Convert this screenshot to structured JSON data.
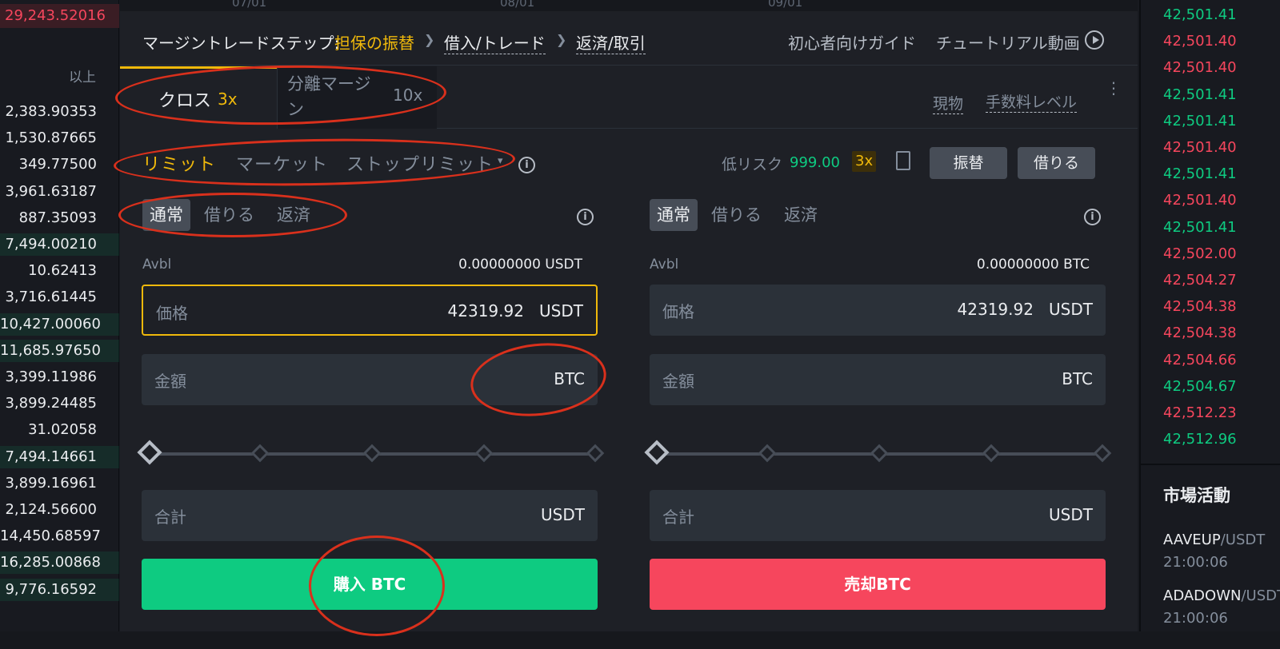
{
  "left_book": {
    "top_value": "29,243.52016",
    "above_label": "以上",
    "values": [
      "2,383.90353",
      "1,530.87665",
      "349.77500",
      "3,961.63187",
      "887.35093",
      "7,494.00210",
      "10.62413",
      "3,716.61445",
      "10,427.00060",
      "11,685.97650",
      "3,399.11986",
      "3,899.24485",
      "31.02058",
      "7,494.14661",
      "3,899.16961",
      "2,124.56600",
      "14,450.68597",
      "16,285.00868",
      "9,776.16592"
    ]
  },
  "chart_axis": {
    "labels": [
      "07/01",
      "08/01",
      "09/01"
    ]
  },
  "steps": {
    "prefix": "マージントレードステップ:",
    "step1": "担保の振替",
    "step2": "借入/トレード",
    "step3": "返済/取引",
    "guide": "初心者向けガイド",
    "video": "チュートリアル動画"
  },
  "mode": {
    "cross_label": "クロス",
    "cross_lev": "3x",
    "iso_label": "分離マージン",
    "iso_lev": "10x",
    "spot": "現物",
    "fee_level": "手数料レベル"
  },
  "order_types": {
    "limit": "リミット",
    "market": "マーケット",
    "stop_limit": "ストップリミット",
    "risk_label": "低リスク",
    "risk_value": "999.00",
    "lev_badge": "3x",
    "transfer": "振替",
    "borrow": "借りる"
  },
  "buy_panel": {
    "tabs": [
      "通常",
      "借りる",
      "返済"
    ],
    "avbl_label": "Avbl",
    "avbl_value": "0.00000000 USDT",
    "price_label": "価格",
    "price_value": "42319.92",
    "price_unit": "USDT",
    "amount_label": "金額",
    "amount_unit": "BTC",
    "total_label": "合計",
    "total_unit": "USDT",
    "button": "購入 BTC",
    "slider_percent": 0
  },
  "sell_panel": {
    "tabs": [
      "通常",
      "借りる",
      "返済"
    ],
    "avbl_label": "Avbl",
    "avbl_value": "0.00000000 BTC",
    "price_label": "価格",
    "price_value": "42319.92",
    "price_unit": "USDT",
    "amount_label": "金額",
    "amount_unit": "BTC",
    "total_label": "合計",
    "total_unit": "USDT",
    "button": "売却BTC",
    "slider_percent": 0
  },
  "trades": {
    "prices": [
      {
        "v": "42,501.41",
        "side": "buy"
      },
      {
        "v": "42,501.40",
        "side": "sell"
      },
      {
        "v": "42,501.40",
        "side": "sell"
      },
      {
        "v": "42,501.41",
        "side": "buy"
      },
      {
        "v": "42,501.41",
        "side": "buy"
      },
      {
        "v": "42,501.40",
        "side": "sell"
      },
      {
        "v": "42,501.41",
        "side": "buy"
      },
      {
        "v": "42,501.40",
        "side": "sell"
      },
      {
        "v": "42,501.41",
        "side": "buy"
      },
      {
        "v": "42,502.00",
        "side": "sell"
      },
      {
        "v": "42,504.27",
        "side": "sell"
      },
      {
        "v": "42,504.38",
        "side": "sell"
      },
      {
        "v": "42,504.38",
        "side": "sell"
      },
      {
        "v": "42,504.66",
        "side": "sell"
      },
      {
        "v": "42,504.67",
        "side": "buy"
      },
      {
        "v": "42,512.23",
        "side": "sell"
      },
      {
        "v": "42,512.96",
        "side": "buy"
      }
    ]
  },
  "market_activity": {
    "title": "市場活動",
    "items": [
      {
        "base": "AAVEUP",
        "quote": "/USDT",
        "time": "21:00:06"
      },
      {
        "base": "ADADOWN",
        "quote": "/USDT",
        "time": "21:00:06"
      }
    ]
  },
  "colors": {
    "accent": "#f0b90b",
    "buy": "#0ecb81",
    "sell": "#f6465d",
    "annotation": "#d9301c"
  }
}
